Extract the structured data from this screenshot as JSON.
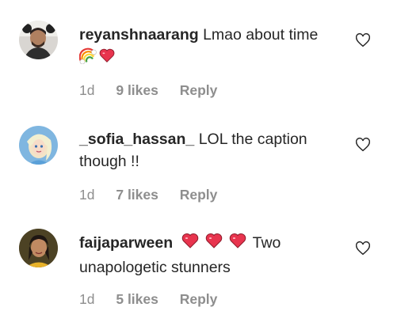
{
  "comments": [
    {
      "username": "reyanshnaarang",
      "text": "Lmao about time",
      "emojis": [
        "rainbow-emoji",
        "heart-emoji"
      ],
      "time": "1d",
      "likes": "9 likes",
      "reply": "Reply"
    },
    {
      "username": "_sofia_hassan_",
      "text": "LOL the caption though !!",
      "emojis": [],
      "time": "1d",
      "likes": "7 likes",
      "reply": "Reply"
    },
    {
      "username": "faijaparween",
      "text": "Two unapologetic stunners",
      "emojis": [
        "heart-emoji",
        "heart-emoji",
        "heart-emoji"
      ],
      "time": "1d",
      "likes": "5 likes",
      "reply": "Reply"
    }
  ],
  "colors": {
    "text": "#262626",
    "meta": "#8e8e8e",
    "heart_emoji": "#e8344e",
    "like_icon_stroke": "#262626"
  }
}
